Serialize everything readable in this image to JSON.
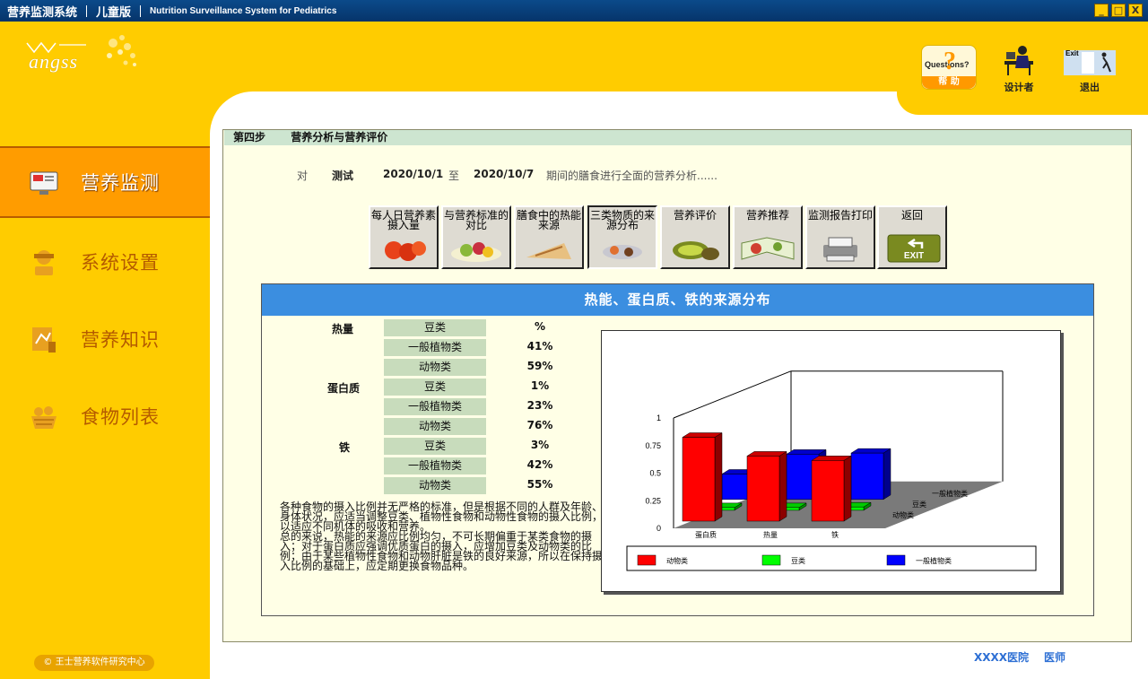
{
  "window": {
    "title": "营养监测系统",
    "edition": "儿童版",
    "subtitle": "Nutrition Surveillance System for Pediatrics",
    "controls": [
      "_",
      "□",
      "X"
    ]
  },
  "logo": {
    "text": "angss"
  },
  "toolbar": {
    "help_text": "Questions?",
    "help_label": "帮 助",
    "designer_label": "设计者",
    "exit_label": "退出",
    "exit_sign": "Exit"
  },
  "sidebar": {
    "items": [
      {
        "label": "营养监测",
        "icon": "monitor-icon",
        "active": true
      },
      {
        "label": "系统设置",
        "icon": "settings-icon",
        "active": false
      },
      {
        "label": "营养知识",
        "icon": "knowledge-icon",
        "active": false
      },
      {
        "label": "食物列表",
        "icon": "food-basket-icon",
        "active": false
      }
    ],
    "copyright": "© 王士营养软件研究中心"
  },
  "step": {
    "number": "第四步",
    "title": "营养分析与营养评价"
  },
  "period": {
    "prefix": "对",
    "name": "测试",
    "start": "2020/10/1",
    "to": "至",
    "end": "2020/10/7",
    "suffix": "期间的膳食进行全面的营养分析......"
  },
  "functions": [
    {
      "label": "每人日营养素摄入量",
      "pressed": false
    },
    {
      "label": "与营养标准的对比",
      "pressed": false
    },
    {
      "label": "膳食中的热能来源",
      "pressed": false
    },
    {
      "label": "三类物质的来源分布",
      "pressed": true
    },
    {
      "label": "营养评价",
      "pressed": false
    },
    {
      "label": "营养推荐",
      "pressed": false
    },
    {
      "label": "监测报告打印",
      "pressed": false
    },
    {
      "label": "返回",
      "pressed": false,
      "badge": "EXIT"
    }
  ],
  "panel": {
    "title": "热能、蛋白质、铁的来源分布",
    "groups": [
      {
        "name": "热量",
        "rows": [
          {
            "source": "豆类",
            "value": "%"
          },
          {
            "source": "一般植物类",
            "value": "41%"
          },
          {
            "source": "动物类",
            "value": "59%"
          }
        ]
      },
      {
        "name": "蛋白质",
        "rows": [
          {
            "source": "豆类",
            "value": "1%"
          },
          {
            "source": "一般植物类",
            "value": "23%"
          },
          {
            "source": "动物类",
            "value": "76%"
          }
        ]
      },
      {
        "name": "铁",
        "rows": [
          {
            "source": "豆类",
            "value": "3%"
          },
          {
            "source": "一般植物类",
            "value": "42%"
          },
          {
            "source": "动物类",
            "value": "55%"
          }
        ]
      }
    ],
    "note": [
      "各种食物的摄入比例并无严格的标准，但是根据不同的人群及年龄、身体状况，应适当调整豆类、植物性食物和动物性食物的摄入比例，以适应不同机体的吸收和营养。",
      "总的来说，热能的来源应比例均匀，不可长期偏重于某类食物的摄入；对于蛋白质应强调优质蛋白的摄入，应增加豆类及动物类的比例；由于某些植物性食物和动物肝脏是铁的良好来源，所以在保持摄入比例的基础上，应定期更换食物品种。"
    ]
  },
  "chart_data": {
    "type": "bar",
    "categories": [
      "蛋白质",
      "热量",
      "铁"
    ],
    "depth_labels": [
      "动物类",
      "豆类",
      "一般植物类"
    ],
    "series": [
      {
        "name": "动物类",
        "color": "#ff0000",
        "values": [
          0.76,
          0.59,
          0.55
        ]
      },
      {
        "name": "豆类",
        "color": "#00ff00",
        "values": [
          0.01,
          0.0,
          0.03
        ]
      },
      {
        "name": "一般植物类",
        "color": "#0000ff",
        "values": [
          0.23,
          0.41,
          0.42
        ]
      }
    ],
    "yticks": [
      "0",
      "0.25",
      "0.5",
      "0.75",
      "1"
    ],
    "ylim": [
      0,
      1
    ],
    "legend": "bottom"
  },
  "footer": {
    "hospital": "XXXX医院",
    "doctor": "医师"
  }
}
